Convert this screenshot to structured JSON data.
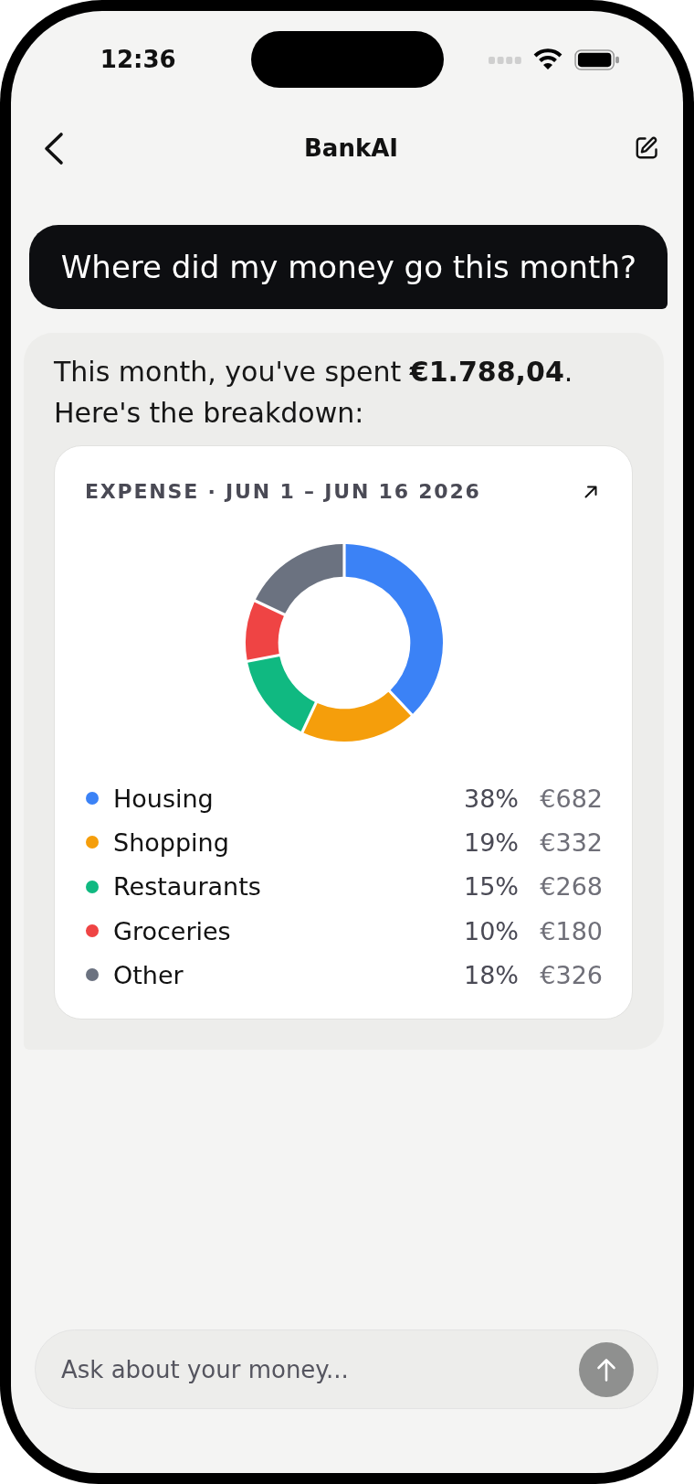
{
  "status_bar": {
    "time": "12:36"
  },
  "nav": {
    "title": "BankAI"
  },
  "messages": [
    {
      "kind": "user",
      "text": "Where did my money go this month?"
    },
    {
      "kind": "assistant",
      "text": "This month, you've spent **€1.788,04**. Here's the breakdown:",
      "card": {
        "title": "EXPENSE · JUN 1 – JUN 16 2026",
        "chart_data": {
          "type": "donut",
          "categories": [
            "Housing",
            "Shopping",
            "Restaurants",
            "Groceries",
            "Other"
          ],
          "values": [
            38,
            19,
            15,
            10,
            18
          ]
        },
        "legend": [
          {
            "percent": "38%",
            "amount": "€682",
            "color": "#3b82f6"
          },
          {
            "percent": "19%",
            "amount": "€332",
            "color": "#f59e0b"
          },
          {
            "percent": "15%",
            "amount": "€268",
            "color": "#10b981"
          },
          {
            "percent": "10%",
            "amount": "€180",
            "color": "#ef4444"
          },
          {
            "percent": "18%",
            "amount": "€326",
            "color": "#6b7280"
          }
        ]
      }
    }
  ],
  "composer": {
    "placeholder": "Ask about your money..."
  }
}
